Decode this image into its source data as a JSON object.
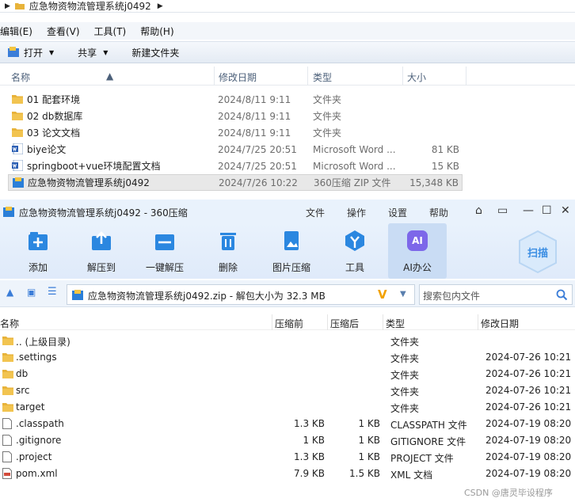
{
  "explorer": {
    "breadcrumb": "应急物资物流管理系统j0492",
    "menu": [
      "编辑(E)",
      "查看(V)",
      "工具(T)",
      "帮助(H)"
    ],
    "toolbar": {
      "open": "打开",
      "share": "共享",
      "new_folder": "新建文件夹"
    },
    "columns": {
      "name": "名称",
      "date": "修改日期",
      "type": "类型",
      "size": "大小"
    },
    "files": [
      {
        "name": "01 配套环境",
        "date": "2024/8/11 9:11",
        "type": "文件夹",
        "size": "",
        "icon": "folder-icon"
      },
      {
        "name": "02 db数据库",
        "date": "2024/8/11 9:11",
        "type": "文件夹",
        "size": "",
        "icon": "folder-icon"
      },
      {
        "name": "03 论文文档",
        "date": "2024/8/11 9:11",
        "type": "文件夹",
        "size": "",
        "icon": "folder-icon"
      },
      {
        "name": "biye论文",
        "date": "2024/7/25 20:51",
        "type": "Microsoft Word ...",
        "size": "81 KB",
        "icon": "word-icon"
      },
      {
        "name": "springboot+vue环境配置文档",
        "date": "2024/7/25 20:51",
        "type": "Microsoft Word ...",
        "size": "15 KB",
        "icon": "word-icon"
      },
      {
        "name": "应急物资物流管理系统j0492",
        "date": "2024/7/26 10:22",
        "type": "360压缩 ZIP 文件",
        "size": "15,348 KB",
        "icon": "zip-icon"
      }
    ]
  },
  "zip": {
    "title": "应急物资物流管理系统j0492 - 360压缩",
    "menu": [
      "文件",
      "操作",
      "设置",
      "帮助"
    ],
    "ribbon": [
      "添加",
      "解压到",
      "一键解压",
      "删除",
      "图片压缩",
      "工具",
      "AI办公"
    ],
    "ai_badge": "AI",
    "scan": "扫描",
    "path": "应急物资物流管理系统j0492.zip - 解包大小为 32.3 MB",
    "search_placeholder": "搜索包内文件",
    "columns": {
      "name": "名称",
      "packed": "压缩前",
      "unpacked": "压缩后",
      "type": "类型",
      "date": "修改日期"
    },
    "entries": [
      {
        "name": ".. (上级目录)",
        "packed": "",
        "unpacked": "",
        "type": "文件夹",
        "date": "",
        "icon": "folder-icon"
      },
      {
        "name": ".settings",
        "packed": "",
        "unpacked": "",
        "type": "文件夹",
        "date": "2024-07-26 10:21",
        "icon": "folder-icon"
      },
      {
        "name": "db",
        "packed": "",
        "unpacked": "",
        "type": "文件夹",
        "date": "2024-07-26 10:21",
        "icon": "folder-icon"
      },
      {
        "name": "src",
        "packed": "",
        "unpacked": "",
        "type": "文件夹",
        "date": "2024-07-26 10:21",
        "icon": "folder-icon"
      },
      {
        "name": "target",
        "packed": "",
        "unpacked": "",
        "type": "文件夹",
        "date": "2024-07-26 10:21",
        "icon": "folder-icon"
      },
      {
        "name": ".classpath",
        "packed": "1.3 KB",
        "unpacked": "1 KB",
        "type": "CLASSPATH 文件",
        "date": "2024-07-19 08:20",
        "icon": "file-icon"
      },
      {
        "name": ".gitignore",
        "packed": "1 KB",
        "unpacked": "1 KB",
        "type": "GITIGNORE 文件",
        "date": "2024-07-19 08:20",
        "icon": "file-icon"
      },
      {
        "name": ".project",
        "packed": "1.3 KB",
        "unpacked": "1 KB",
        "type": "PROJECT 文件",
        "date": "2024-07-19 08:20",
        "icon": "file-icon"
      },
      {
        "name": "pom.xml",
        "packed": "7.9 KB",
        "unpacked": "1.5 KB",
        "type": "XML 文档",
        "date": "2024-07-19 08:20",
        "icon": "xml-file-icon"
      }
    ]
  },
  "watermark": "CSDN @唐灵毕设程序",
  "colors": {
    "accent": "#2b7fd8",
    "folder": "#e8b33a",
    "ribbon_bg": "#e9f2fc"
  }
}
